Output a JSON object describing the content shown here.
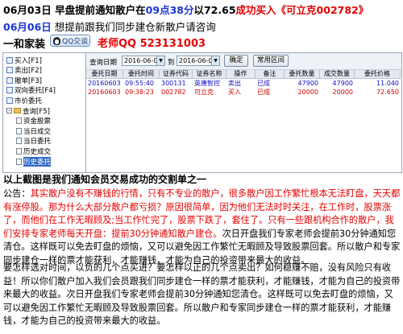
{
  "header": {
    "line1": {
      "date": "06月03日",
      "text_a": "早盘提前通知散户在",
      "time": "09点38分",
      "text_b": "以",
      "price": "72.65",
      "text_c": "成功买入",
      "stock": "《可立克002782》"
    },
    "line2": {
      "date": "06月06日",
      "text": "想提前跟我们同步建仓新散户请咨询"
    },
    "line3": {
      "brand": "一和家装",
      "qq_button": "QQ交谈",
      "teacher": "老师QQ 523131003"
    }
  },
  "screenshot": {
    "tree": [
      {
        "label": "买入[F1]",
        "indent": 0,
        "icon": "tico"
      },
      {
        "label": "卖出[F2]",
        "indent": 0,
        "icon": "tico"
      },
      {
        "label": "撤单[F3]",
        "indent": 0,
        "icon": "tico"
      },
      {
        "label": "双向委托[F4]",
        "indent": 0,
        "icon": "tico"
      },
      {
        "label": "市价委托",
        "indent": 0,
        "icon": "tico"
      },
      {
        "label": "查询[F5]",
        "indent": 0,
        "icon": "fold",
        "expanded": true
      },
      {
        "label": "资金股票",
        "indent": 1,
        "icon": "doc"
      },
      {
        "label": "当日成交",
        "indent": 1,
        "icon": "doc"
      },
      {
        "label": "当日委托",
        "indent": 1,
        "icon": "doc"
      },
      {
        "label": "历史成交",
        "indent": 1,
        "icon": "doc"
      },
      {
        "label": "历史委托",
        "indent": 1,
        "icon": "doc",
        "selected": true
      }
    ],
    "toolbar": {
      "label_date": "查询日期",
      "date_from": "2016-06-03",
      "to": "到",
      "date_to": "2016-06-03",
      "confirm": "确定",
      "common_range": "常用区间"
    },
    "table": {
      "headers": [
        "委托日期",
        "委托时间",
        "证券代码",
        "证券名称",
        "操作",
        "备注",
        "委托数量",
        "成交数量",
        "委托价格"
      ],
      "rows": [
        [
          "20160603",
          "09:55:40",
          "300131",
          "英唐智控",
          "卖出",
          "已成",
          "47900",
          "47900",
          "11.040"
        ],
        [
          "20160603",
          "09:38:23",
          "002782",
          "可立克",
          "买入",
          "已成",
          "20000",
          "20000",
          "72.650"
        ]
      ]
    }
  },
  "caption": "以上截图是我们通知会员交易成功的交割单之一",
  "notice": {
    "label": "公告：",
    "p1": "其实散户没有不赚钱的行情，只有不专业的散户，很多散户因工作繁忙根本无法盯盘，天天都有涨停股。那为什么大部分散户都亏损？原因很简单，因为他们无法时时关注，在工作时，股票涨了，而他们在工作无暇顾及;当工作忙完了，股票下跌了，套住了。只有一些跟机构合作的散户，我们安排专家老师每天开盘：提前30分钟通知散户建仓。",
    "p2": "次日开盘我们专家老师会提前30分钟通知您清仓。这样既可以免去盯盘的烦恼，又可以避免因工作繁忙无暇顾及导致股票回套。所以散户和专家同步建仓一样的票才能获利，才能赚钱，才能为自己的投资带来最大的收益。"
  },
  "body_text": "要怎样选对时间，以负的几个点买进？要怎样以正的几个点卖出？如何稳赚不赔，没有风险只有收益！所以你们散户加入我们会员跟我们同步建仓一样的票才能获利，才能赚钱，才能为自己的投资带来最大的收益。次日开盘我们专家老师会提前30分钟通知您清仓。这样既可以免去盯盘的烦恼，又可以避免因工作繁忙无暇顾及导致股票回套。所以散户和专家同步建仓一样的票才能获利，才能赚钱，才能为自己的投资带来最大的收益。"
}
